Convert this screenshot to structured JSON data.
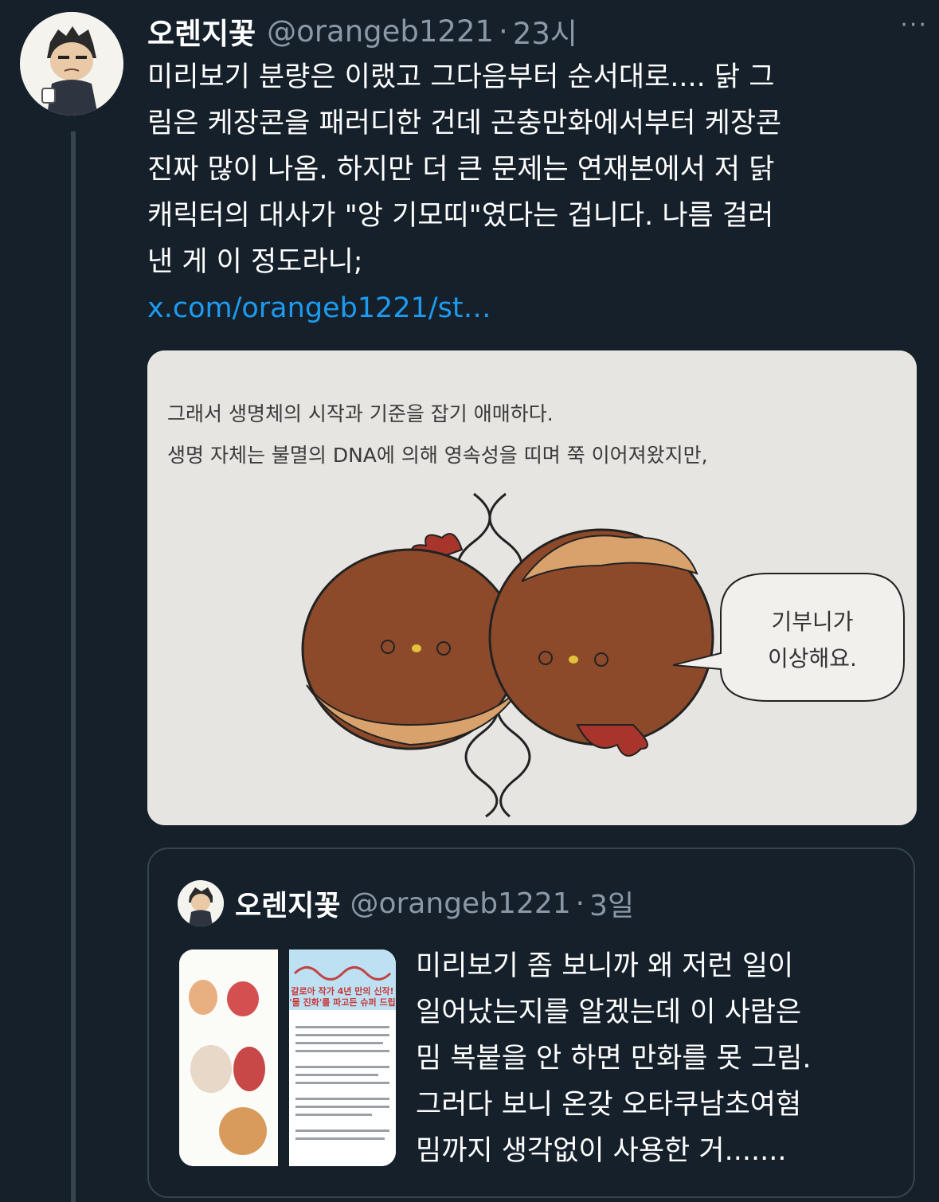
{
  "tweet": {
    "display_name": "오렌지꽃",
    "handle": "@orangeb1221",
    "separator": "·",
    "time": "23시",
    "more_icon": "···",
    "text": "미리보기 분량은 이랬고 그다음부터 순서대로.... 닭 그\n림은 케장콘을 패러디한 건데 곤충만화에서부터 케장콘\n진짜 많이 나옴. 하지만 더 큰 문제는 연재본에서 저 닭\n캐릭터의 대사가 \"앙 기모띠\"였다는 겁니다. 나름 걸러\n낸 게 이 정도라니;",
    "link": "x.com/orangeb1221/st…",
    "media": {
      "caption_line1": "그래서 생명체의 시작과 기준을 잡기 애매하다.",
      "caption_line2": "생명 자체는 불멸의 DNA에 의해 영속성을 띠며 쭉 이어져왔지만,",
      "bubble_line1": "기부니가",
      "bubble_line2": "이상해요."
    }
  },
  "quoted_tweet": {
    "display_name": "오렌지꽃",
    "handle": "@orangeb1221",
    "separator": "·",
    "time": "3일",
    "text": "미리보기 좀 보니까 왜 저런 일이\n일어났는지를 알겠는데 이 사람은\n밈 복붙을 안 하면 만화를 못 그림.\n그러다 보니 온갖 오타쿠남초여혐\n밈까지 생각없이 사용한 거.......",
    "thumbnail": {
      "headline_line1": "갈로아 작가 4년 만의 신작!",
      "headline_line2": "'물 진화'를 파고든 슈퍼 드립"
    }
  },
  "colors": {
    "background": "#15202b",
    "muted": "#8b98a5",
    "link": "#1d9bf0",
    "border": "#38444d"
  }
}
